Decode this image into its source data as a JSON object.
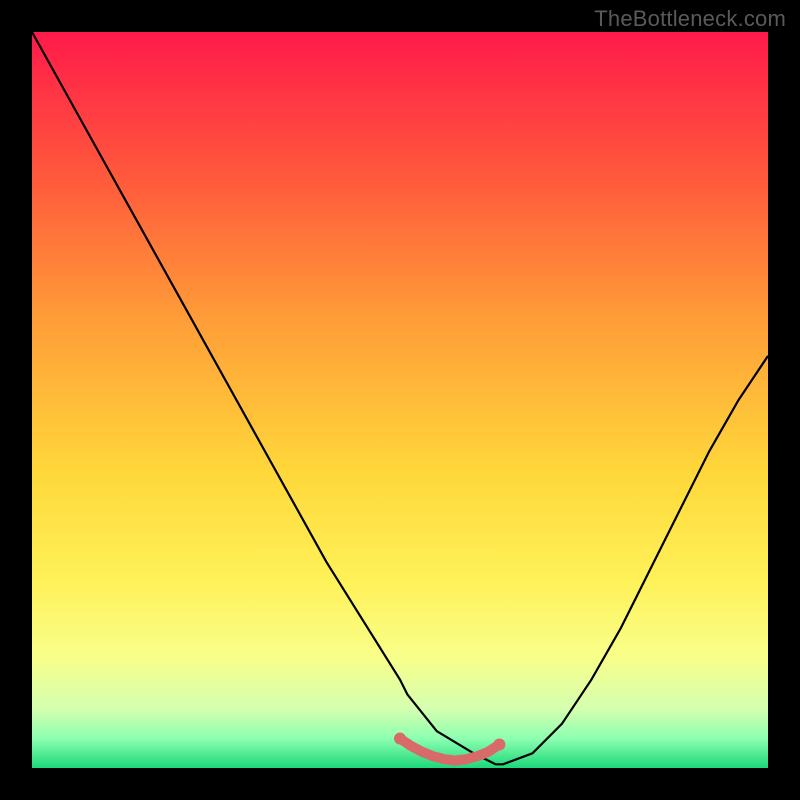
{
  "watermark": "TheBottleneck.com",
  "chart_data": {
    "type": "line",
    "title": "",
    "xlabel": "",
    "ylabel": "",
    "xlim": [
      0,
      100
    ],
    "ylim": [
      0,
      100
    ],
    "background_gradient": {
      "type": "vertical",
      "stops": [
        {
          "pos": 0.0,
          "color": "#ff1a4a"
        },
        {
          "pos": 0.2,
          "color": "#ff5a3c"
        },
        {
          "pos": 0.4,
          "color": "#ffa038"
        },
        {
          "pos": 0.6,
          "color": "#ffd83a"
        },
        {
          "pos": 0.75,
          "color": "#fff25a"
        },
        {
          "pos": 0.85,
          "color": "#f8ff8a"
        },
        {
          "pos": 0.92,
          "color": "#d4ffb0"
        },
        {
          "pos": 0.96,
          "color": "#8cffb0"
        },
        {
          "pos": 1.0,
          "color": "#1cd87a"
        }
      ]
    },
    "series": [
      {
        "name": "bottleneck-curve",
        "color": "#000000",
        "x": [
          0,
          5,
          10,
          15,
          20,
          25,
          30,
          35,
          40,
          45,
          50,
          51,
          55,
          60,
          63,
          64,
          68,
          72,
          76,
          80,
          84,
          88,
          92,
          96,
          100
        ],
        "y": [
          100,
          91,
          82,
          73,
          64,
          55,
          46,
          37,
          28,
          20,
          12,
          10,
          5,
          2,
          0.5,
          0.5,
          2,
          6,
          12,
          19,
          27,
          35,
          43,
          50,
          56
        ]
      },
      {
        "name": "optimal-range-marker",
        "color": "#d86a6a",
        "marker": true,
        "x": [
          50,
          51.5,
          53,
          54.5,
          56,
          57.5,
          59,
          60.5,
          62,
          63.5
        ],
        "y": [
          4,
          3,
          2.2,
          1.6,
          1.2,
          1.0,
          1.2,
          1.6,
          2.2,
          3.2
        ]
      }
    ]
  }
}
